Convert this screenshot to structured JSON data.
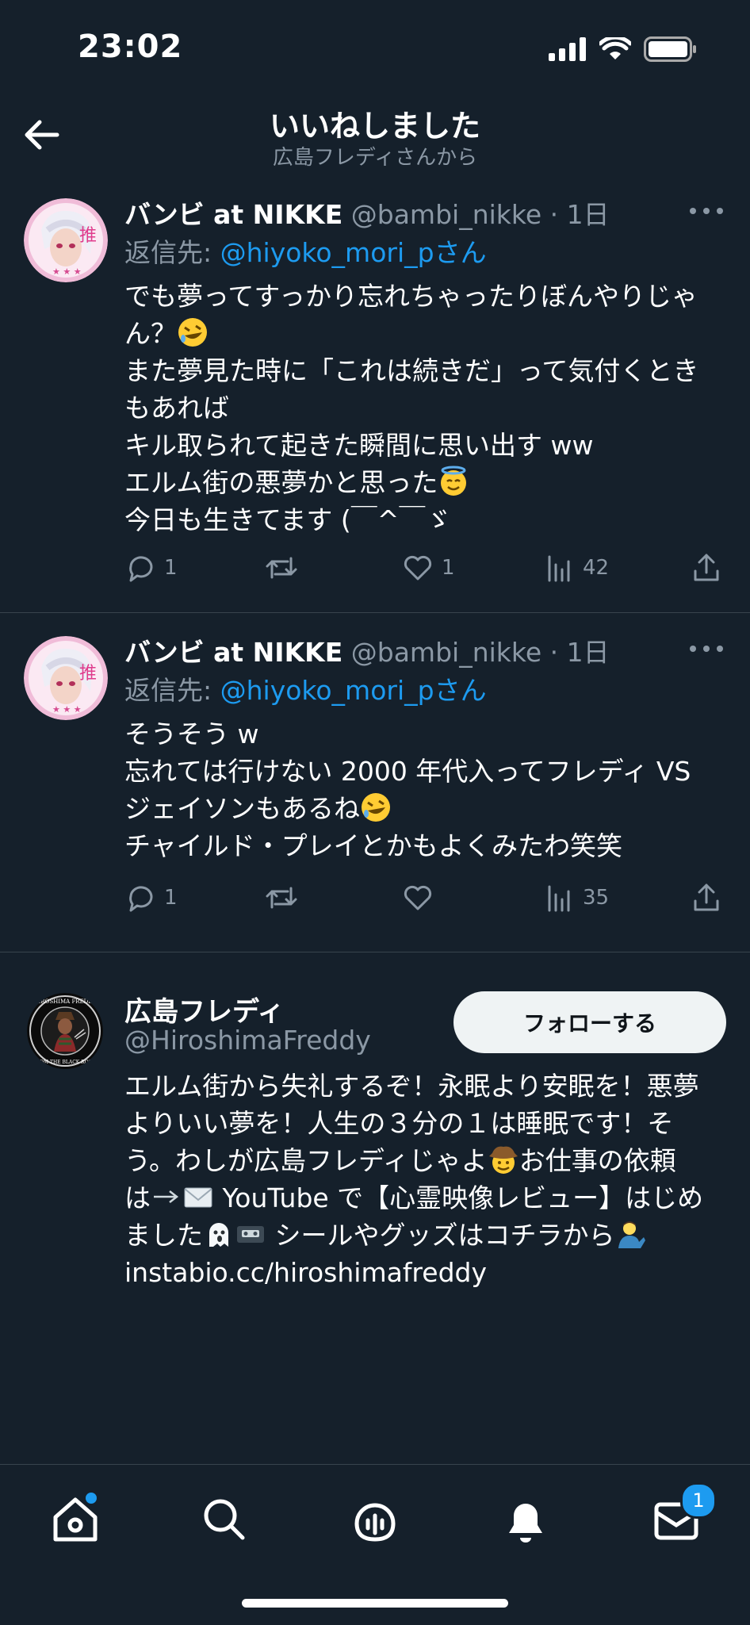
{
  "status_bar": {
    "time": "23:02"
  },
  "header": {
    "title": "いいねしました",
    "subtitle": "広島フレディさんから"
  },
  "tweets": [
    {
      "name": "バンビ at NIKKE",
      "handle": "@bambi_nikke",
      "dot": "·",
      "ago": "1日",
      "reply_prefix": "返信先:",
      "reply_handle": "@hiyoko_mori_p",
      "reply_suffix": "さん",
      "lines": [
        "でも夢ってすっかり忘れちゃったりぼんやりじゃ",
        "ん？",
        "また夢見た時に「これは続きだ」って気付くとき",
        "もあれば",
        "キル取られて起きた瞬間に思い出す ww",
        "エルム街の悪夢かと思った",
        "今日も生きてます (￣^￣ゞ"
      ],
      "emojis": [
        "rolling-on-floor-laughing",
        "smiling-face-with-halo"
      ],
      "stats": {
        "replies": "1",
        "retweets": "",
        "likes": "1",
        "views": "42"
      }
    },
    {
      "name": "バンビ at NIKKE",
      "handle": "@bambi_nikke",
      "dot": "·",
      "ago": "1日",
      "reply_prefix": "返信先:",
      "reply_handle": "@hiyoko_mori_p",
      "reply_suffix": "さん",
      "lines": [
        "そうそう w",
        "忘れては行けない 2000 年代入ってフレディ VS",
        "ジェイソンもあるね",
        "チャイルド・プレイとかもよくみたわ笑笑"
      ],
      "emojis": [
        "rolling-on-floor-laughing"
      ],
      "stats": {
        "replies": "1",
        "retweets": "",
        "likes": "",
        "views": "35"
      }
    }
  ],
  "profile": {
    "name": "広島フレディ",
    "handle": "@HiroshimaFreddy",
    "follow_label": "フォローする",
    "bio_lines": [
      "エルム街から失礼するぞ！永眠より安眠を！悪夢",
      "よりいい夢を！人生の３分の１は睡眠です！そ",
      "う。わしが広島フレディじゃよ",
      "お仕事の依頼",
      "は",
      "YouTube で【心霊映像レビュー】はじめ",
      "ました",
      "シールやグッズはコチラから",
      "instabio.cc/hiroshimafreddy"
    ],
    "avatar_text": [
      "HIROSHIMA FREDDY",
      "FROM THE BLACK ROOM"
    ],
    "emojis": [
      "cowboy-face",
      "right-arrow",
      "envelope",
      "ghost",
      "videocassette",
      "person-tipping-hand"
    ]
  },
  "nav": {
    "items": [
      "home-icon",
      "search-icon",
      "spaces-icon",
      "notifications-icon",
      "messages-icon"
    ],
    "messages_badge": "1"
  },
  "colors": {
    "background": "#15202b",
    "link": "#1d9bf0",
    "muted": "#8b98a5",
    "divider": "#38444d"
  }
}
